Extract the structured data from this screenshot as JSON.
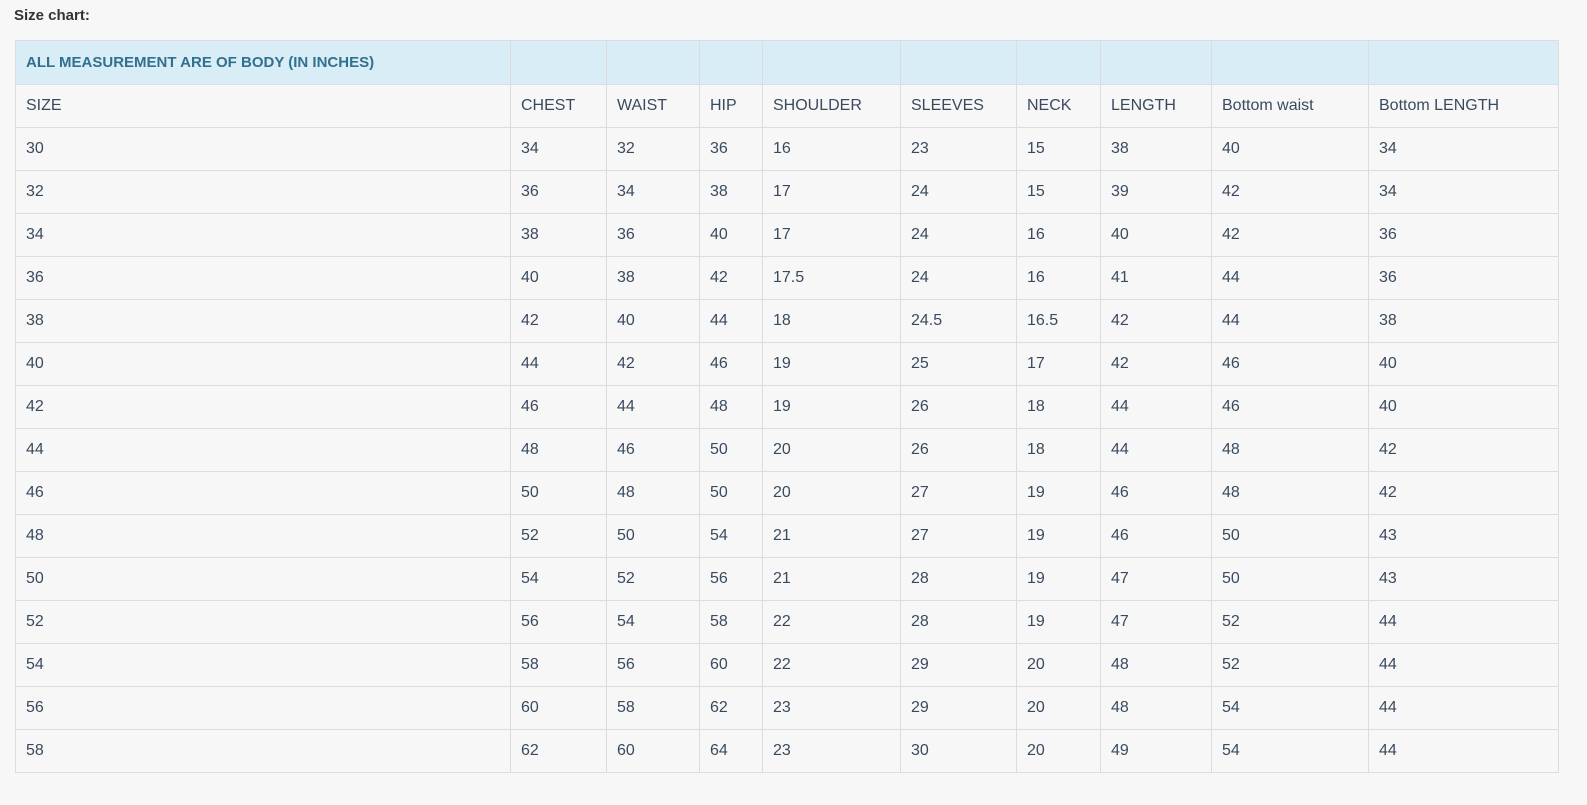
{
  "title": "Size chart:",
  "banner": "ALL MEASUREMENT ARE OF BODY (IN INCHES)",
  "colors": {
    "banner_bg": "#d9edf7",
    "banner_text": "#31708f",
    "border": "#dcdcdc",
    "page_bg": "#f7f7f7"
  },
  "table": {
    "columns": [
      "SIZE",
      "CHEST",
      "WAIST",
      "HIP",
      "SHOULDER",
      "SLEEVES",
      "NECK",
      "LENGTH",
      "Bottom waist",
      "Bottom LENGTH"
    ],
    "rows": [
      [
        "30",
        "34",
        "32",
        "36",
        "16",
        "23",
        "15",
        "38",
        "40",
        "34"
      ],
      [
        "32",
        "36",
        "34",
        "38",
        "17",
        "24",
        "15",
        "39",
        "42",
        "34"
      ],
      [
        "34",
        "38",
        "36",
        "40",
        "17",
        "24",
        "16",
        "40",
        "42",
        "36"
      ],
      [
        "36",
        "40",
        "38",
        "42",
        "17.5",
        "24",
        "16",
        "41",
        "44",
        "36"
      ],
      [
        "38",
        "42",
        "40",
        "44",
        "18",
        "24.5",
        "16.5",
        "42",
        "44",
        "38"
      ],
      [
        "40",
        "44",
        "42",
        "46",
        "19",
        "25",
        "17",
        "42",
        "46",
        "40"
      ],
      [
        "42",
        "46",
        "44",
        "48",
        "19",
        "26",
        "18",
        "44",
        "46",
        "40"
      ],
      [
        "44",
        "48",
        "46",
        "50",
        "20",
        "26",
        "18",
        "44",
        "48",
        "42"
      ],
      [
        "46",
        "50",
        "48",
        "50",
        "20",
        "27",
        "19",
        "46",
        "48",
        "42"
      ],
      [
        "48",
        "52",
        "50",
        "54",
        "21",
        "27",
        "19",
        "46",
        "50",
        "43"
      ],
      [
        "50",
        "54",
        "52",
        "56",
        "21",
        "28",
        "19",
        "47",
        "50",
        "43"
      ],
      [
        "52",
        "56",
        "54",
        "58",
        "22",
        "28",
        "19",
        "47",
        "52",
        "44"
      ],
      [
        "54",
        "58",
        "56",
        "60",
        "22",
        "29",
        "20",
        "48",
        "52",
        "44"
      ],
      [
        "56",
        "60",
        "58",
        "62",
        "23",
        "29",
        "20",
        "48",
        "54",
        "44"
      ],
      [
        "58",
        "62",
        "60",
        "64",
        "23",
        "30",
        "20",
        "49",
        "54",
        "44"
      ]
    ]
  }
}
